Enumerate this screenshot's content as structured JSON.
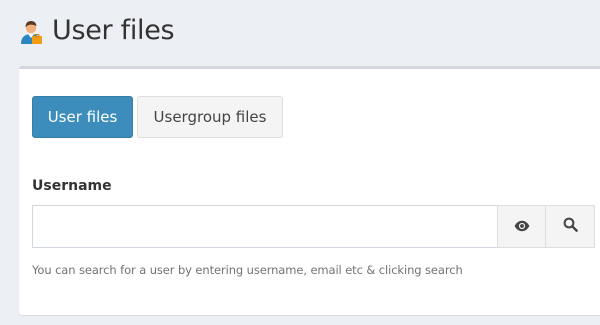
{
  "header": {
    "title": "User files",
    "icon": "user-icon"
  },
  "tabs": [
    {
      "label": "User files",
      "active": true
    },
    {
      "label": "Usergroup files",
      "active": false
    }
  ],
  "form": {
    "username_label": "Username",
    "username_value": "",
    "username_placeholder": "",
    "eye_button_icon": "eye-icon",
    "search_button_icon": "search-icon",
    "help_text": "You can search for a user by entering username, email etc & clicking search"
  },
  "colors": {
    "primary": "#3c8dbc",
    "page_background": "#eceff3",
    "panel_background": "#ffffff",
    "panel_top_border": "#d2d6de"
  }
}
